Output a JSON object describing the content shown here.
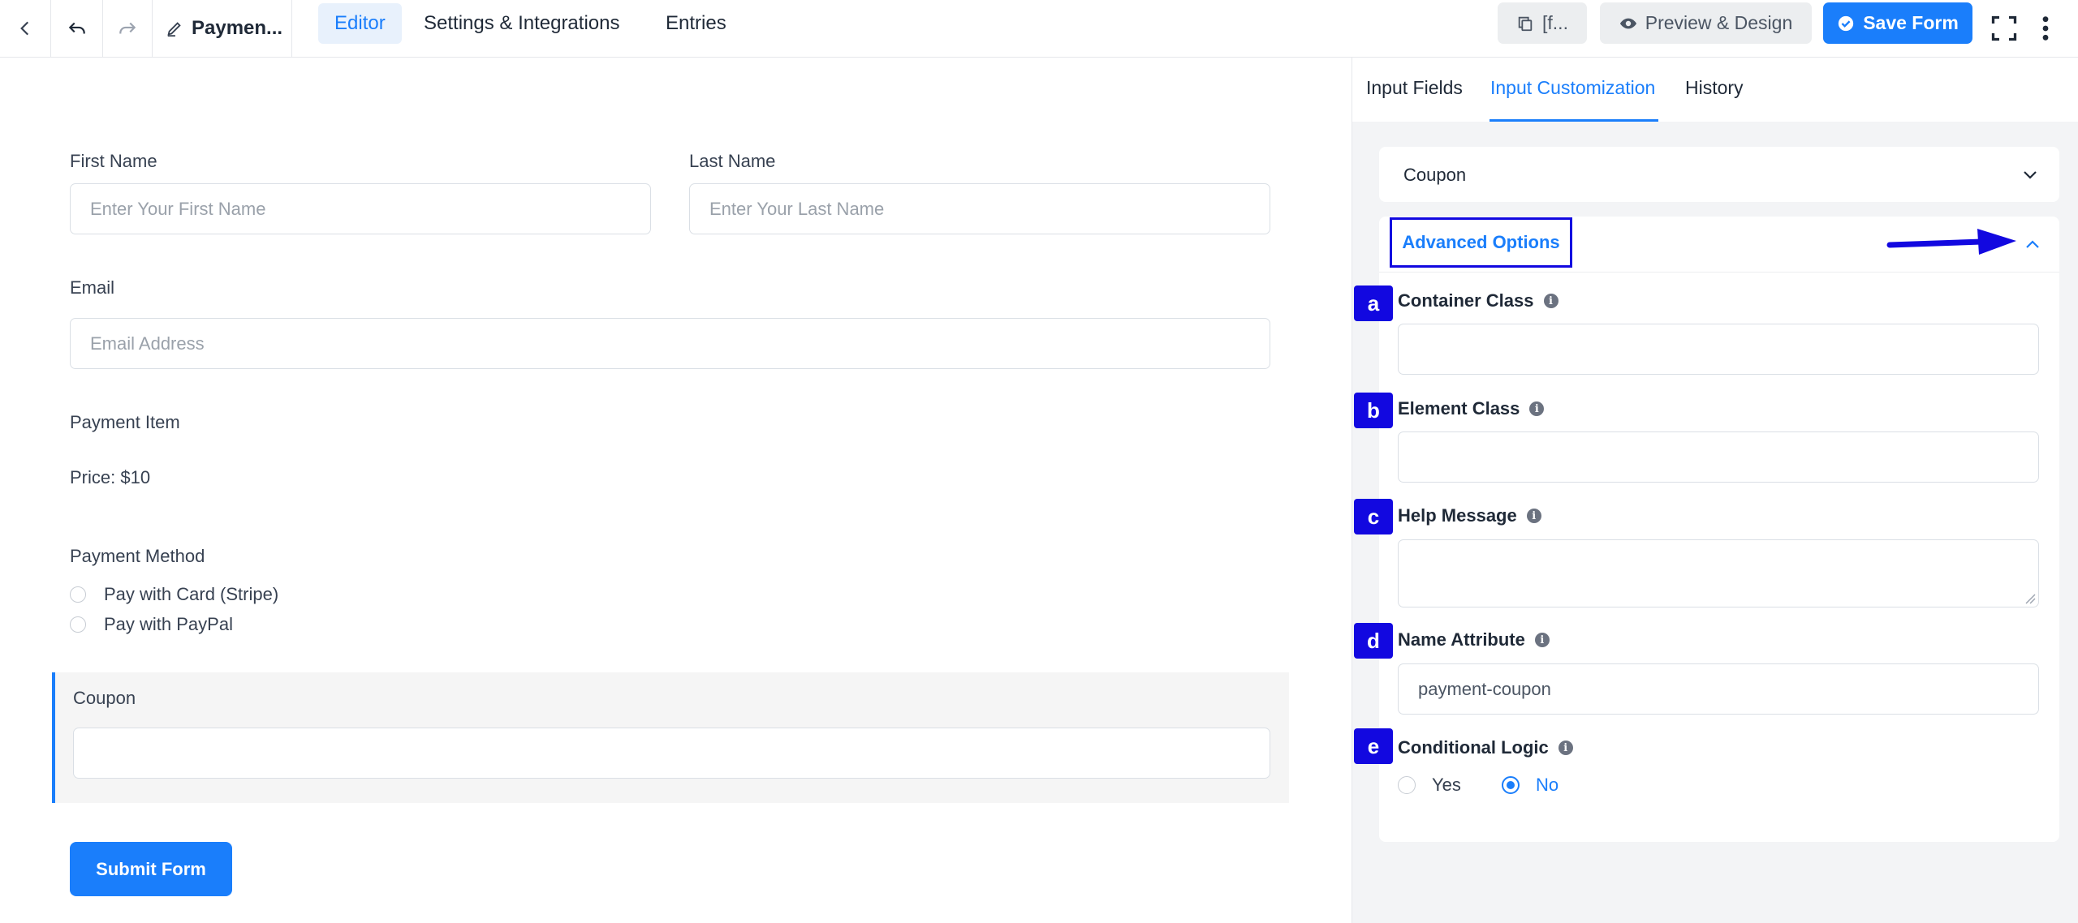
{
  "topbar": {
    "form_name": "Paymen...",
    "tabs": [
      {
        "label": "Editor"
      },
      {
        "label": "Settings & Integrations"
      },
      {
        "label": "Entries"
      }
    ],
    "shortcode_label": "[f...",
    "preview_label": "Preview & Design",
    "save_label": "Save Form"
  },
  "form": {
    "first_name": {
      "label": "First Name",
      "placeholder": "Enter Your First Name"
    },
    "last_name": {
      "label": "Last Name",
      "placeholder": "Enter Your Last Name"
    },
    "email": {
      "label": "Email",
      "placeholder": "Email Address"
    },
    "payment_item": {
      "label": "Payment Item",
      "price": "Price: $10"
    },
    "payment_method": {
      "label": "Payment Method",
      "options": [
        "Pay with Card (Stripe)",
        "Pay with PayPal"
      ]
    },
    "coupon": {
      "label": "Coupon"
    },
    "submit_label": "Submit Form"
  },
  "panel": {
    "tabs": [
      {
        "label": "Input Fields"
      },
      {
        "label": "Input Customization"
      },
      {
        "label": "History"
      }
    ],
    "field_card_title": "Coupon",
    "advanced_title": "Advanced Options",
    "fields": [
      {
        "badge": "a",
        "label": "Container Class",
        "value": ""
      },
      {
        "badge": "b",
        "label": "Element Class",
        "value": ""
      },
      {
        "badge": "c",
        "label": "Help Message",
        "value": ""
      },
      {
        "badge": "d",
        "label": "Name Attribute",
        "value": "payment-coupon"
      },
      {
        "badge": "e",
        "label": "Conditional Logic"
      }
    ],
    "conditional_options": [
      {
        "label": "Yes",
        "checked": false
      },
      {
        "label": "No",
        "checked": true
      }
    ]
  },
  "colors": {
    "accent": "#1a7efb",
    "annotation": "#1208e0"
  }
}
